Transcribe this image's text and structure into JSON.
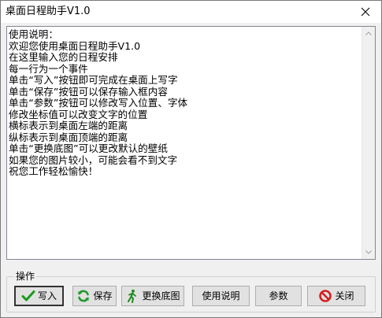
{
  "window": {
    "title": "桌面日程助手V1.0"
  },
  "editor": {
    "lines": [
      "使用说明：",
      "欢迎您使用桌面日程助手V1.0",
      "在这里输入您的日程安排",
      "每一行为一个事件",
      "单击“写入”按钮即可完成在桌面上写字",
      "单击“保存”按钮可以保存输入框内容",
      "单击“参数”按钮可以修改写入位置、字体",
      "修改坐标值可以改变文字的位置",
      "横标表示到桌面左端的距离",
      "纵标表示到桌面顶端的距离",
      "单击“更换底图”可以更改默认的壁纸",
      "如果您的图片较小，可能会看不到文字",
      "祝您工作轻松愉快！"
    ]
  },
  "group": {
    "label": "操作"
  },
  "buttons": {
    "write": {
      "label": "写入",
      "icon": "checkmark-icon",
      "color": "#1a9a1a"
    },
    "save": {
      "label": "保存",
      "icon": "refresh-icon",
      "color": "#1f9a2a"
    },
    "change_bg": {
      "label": "更换底图",
      "icon": "running-man-icon",
      "color": "#1a8a1a"
    },
    "help": {
      "label": "使用说明"
    },
    "params": {
      "label": "参数"
    },
    "close": {
      "label": "关闭",
      "icon": "no-entry-icon",
      "color": "#d42020"
    }
  }
}
